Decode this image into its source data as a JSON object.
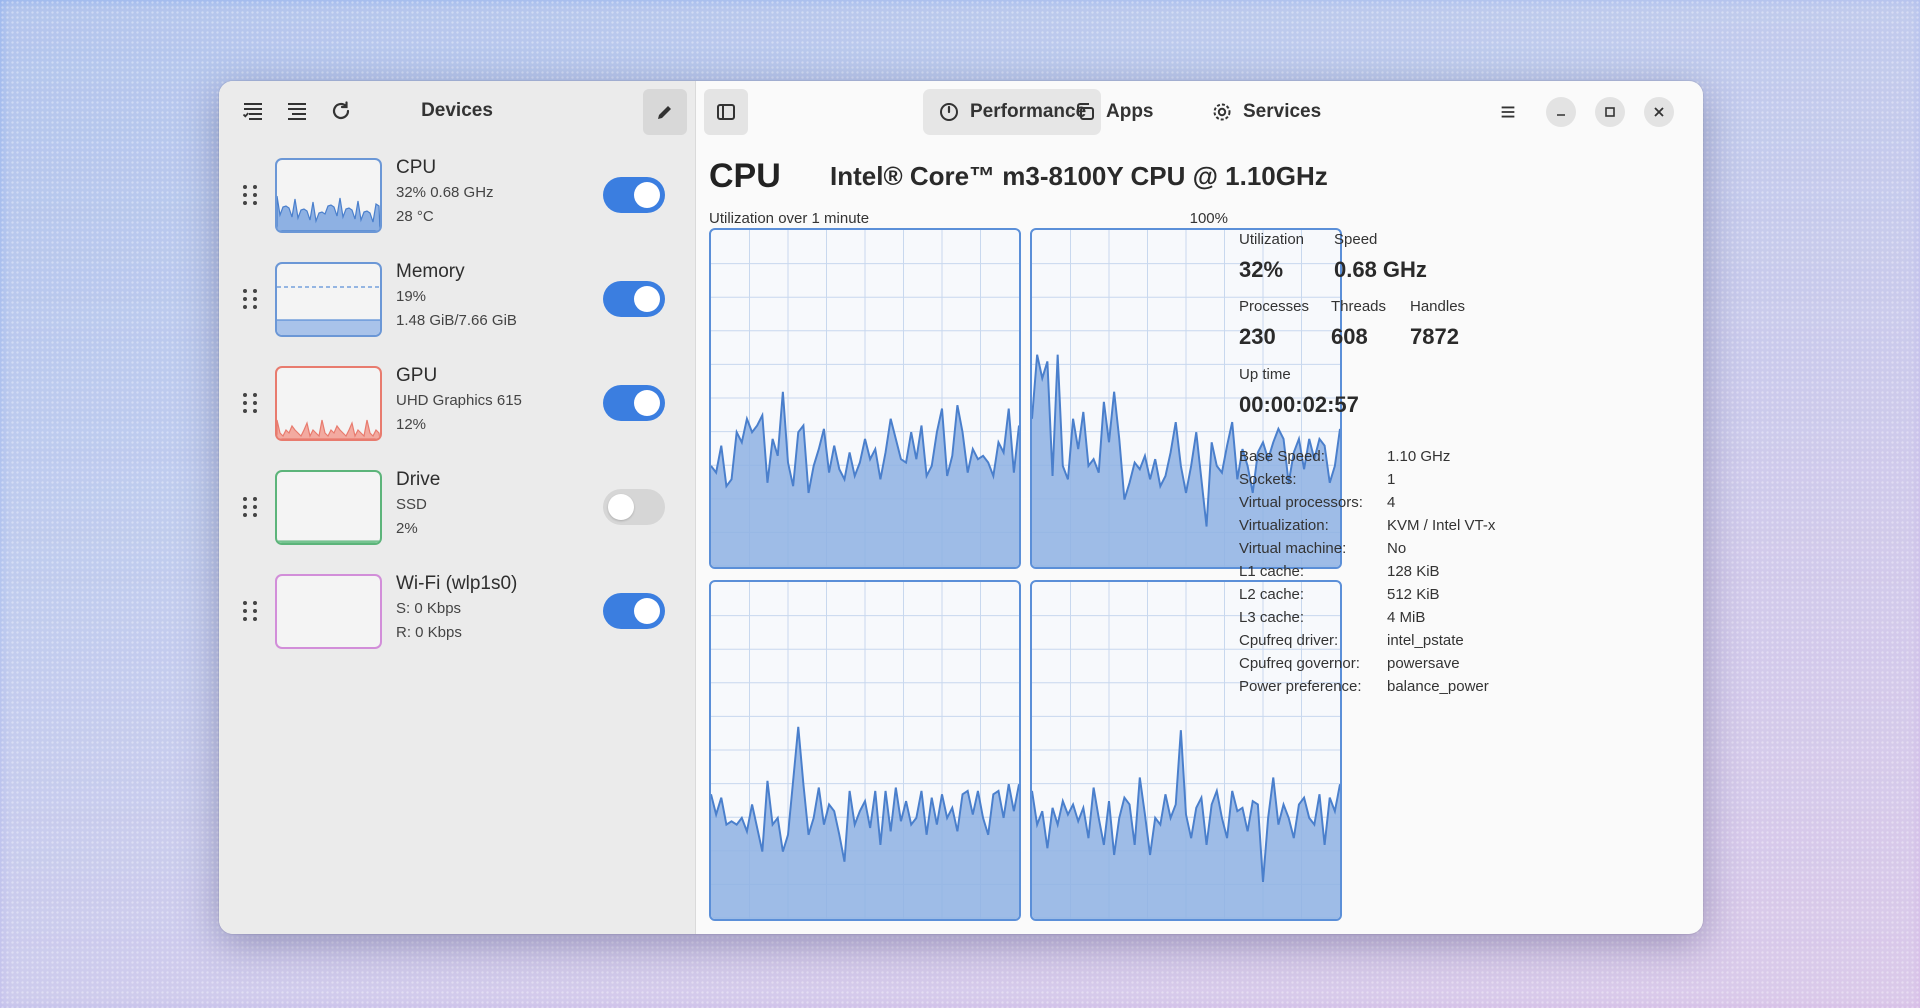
{
  "sidebar": {
    "title": "Devices",
    "devices": [
      {
        "name": "CPU",
        "line1": "32% 0.68 GHz",
        "line2": "28 °C",
        "enabled": true,
        "color": "#6b97d6"
      },
      {
        "name": "Memory",
        "line1": "19%",
        "line2": "1.48 GiB/7.66 GiB",
        "enabled": true,
        "color": "#6b97d6"
      },
      {
        "name": "GPU",
        "line1": "UHD Graphics 615",
        "line2": "12%",
        "enabled": true,
        "color": "#e87b6e"
      },
      {
        "name": "Drive",
        "line1": "SSD",
        "line2": "2%",
        "enabled": false,
        "color": "#5cb47a"
      },
      {
        "name": "Wi-Fi (wlp1s0)",
        "line1": "S: 0 Kbps",
        "line2": "R: 0 Kbps",
        "enabled": true,
        "color": "#d28ed9"
      }
    ]
  },
  "tabs": [
    {
      "label": "Performance",
      "icon": "gauge-icon",
      "active": true
    },
    {
      "label": "Apps",
      "icon": "copy-icon",
      "active": false
    },
    {
      "label": "Services",
      "icon": "gear-icon",
      "active": false
    }
  ],
  "cpu": {
    "title": "CPU",
    "model": "Intel® Core™ m3-8100Y CPU @ 1.10GHz",
    "graph_label": "Utilization over 1 minute",
    "graph_max": "100%",
    "cores": [
      [
        30,
        28,
        36,
        24,
        26,
        40,
        37,
        44,
        40,
        42,
        45,
        25,
        38,
        33,
        52,
        31,
        24,
        40,
        42,
        22,
        30,
        35,
        41,
        28,
        36,
        29,
        26,
        34,
        27,
        31,
        38,
        32,
        35,
        26,
        34,
        44,
        38,
        32,
        31,
        40,
        32,
        42,
        27,
        30,
        40,
        47,
        27,
        33,
        48,
        40,
        28,
        35,
        32,
        33,
        31,
        27,
        37,
        34,
        47,
        28,
        42
      ],
      [
        44,
        63,
        56,
        61,
        27,
        63,
        30,
        26,
        44,
        35,
        46,
        30,
        32,
        28,
        49,
        37,
        52,
        38,
        20,
        25,
        31,
        29,
        33,
        26,
        32,
        24,
        27,
        34,
        43,
        30,
        22,
        30,
        40,
        26,
        12,
        37,
        30,
        28,
        36,
        43,
        26,
        35,
        30,
        22,
        34,
        37,
        32,
        37,
        41,
        38,
        25,
        34,
        38,
        29,
        38,
        32,
        38,
        36,
        25,
        30,
        41
      ],
      [
        37,
        31,
        36,
        28,
        29,
        28,
        30,
        26,
        34,
        27,
        20,
        41,
        28,
        30,
        20,
        25,
        41,
        57,
        40,
        25,
        30,
        39,
        28,
        34,
        32,
        25,
        17,
        38,
        28,
        32,
        35,
        27,
        38,
        22,
        38,
        26,
        39,
        29,
        35,
        28,
        30,
        38,
        25,
        36,
        28,
        37,
        30,
        33,
        26,
        37,
        38,
        31,
        38,
        30,
        25,
        37,
        38,
        30,
        40,
        32,
        40
      ],
      [
        38,
        28,
        32,
        21,
        33,
        28,
        35,
        31,
        34,
        29,
        33,
        24,
        39,
        30,
        22,
        35,
        19,
        30,
        36,
        34,
        22,
        42,
        31,
        19,
        30,
        28,
        37,
        30,
        34,
        56,
        31,
        24,
        33,
        36,
        22,
        34,
        38,
        30,
        24,
        38,
        32,
        33,
        26,
        35,
        34,
        11,
        30,
        42,
        28,
        34,
        30,
        24,
        34,
        36,
        30,
        28,
        37,
        22,
        36,
        32,
        40
      ]
    ]
  },
  "stats": {
    "utilization_label": "Utilization",
    "utilization": "32%",
    "speed_label": "Speed",
    "speed": "0.68 GHz",
    "processes_label": "Processes",
    "processes": "230",
    "threads_label": "Threads",
    "threads": "608",
    "handles_label": "Handles",
    "handles": "7872",
    "uptime_label": "Up time",
    "uptime": "00:00:02:57",
    "details": [
      {
        "k": "Base Speed:",
        "v": "1.10 GHz"
      },
      {
        "k": "Sockets:",
        "v": "1"
      },
      {
        "k": "Virtual processors:",
        "v": "4"
      },
      {
        "k": "Virtualization:",
        "v": "KVM / Intel VT-x"
      },
      {
        "k": "Virtual machine:",
        "v": "No"
      },
      {
        "k": "L1 cache:",
        "v": "128 KiB"
      },
      {
        "k": "L2 cache:",
        "v": "512 KiB"
      },
      {
        "k": "L3 cache:",
        "v": "4 MiB"
      },
      {
        "k": "Cpufreq driver:",
        "v": "intel_pstate"
      },
      {
        "k": "Cpufreq governor:",
        "v": "powersave"
      },
      {
        "k": "Power preference:",
        "v": "balance_power"
      }
    ]
  },
  "colors": {
    "accent": "#3b7ee0",
    "graph_line": "#4a7fcc",
    "graph_fill": "#8eb1e3"
  }
}
